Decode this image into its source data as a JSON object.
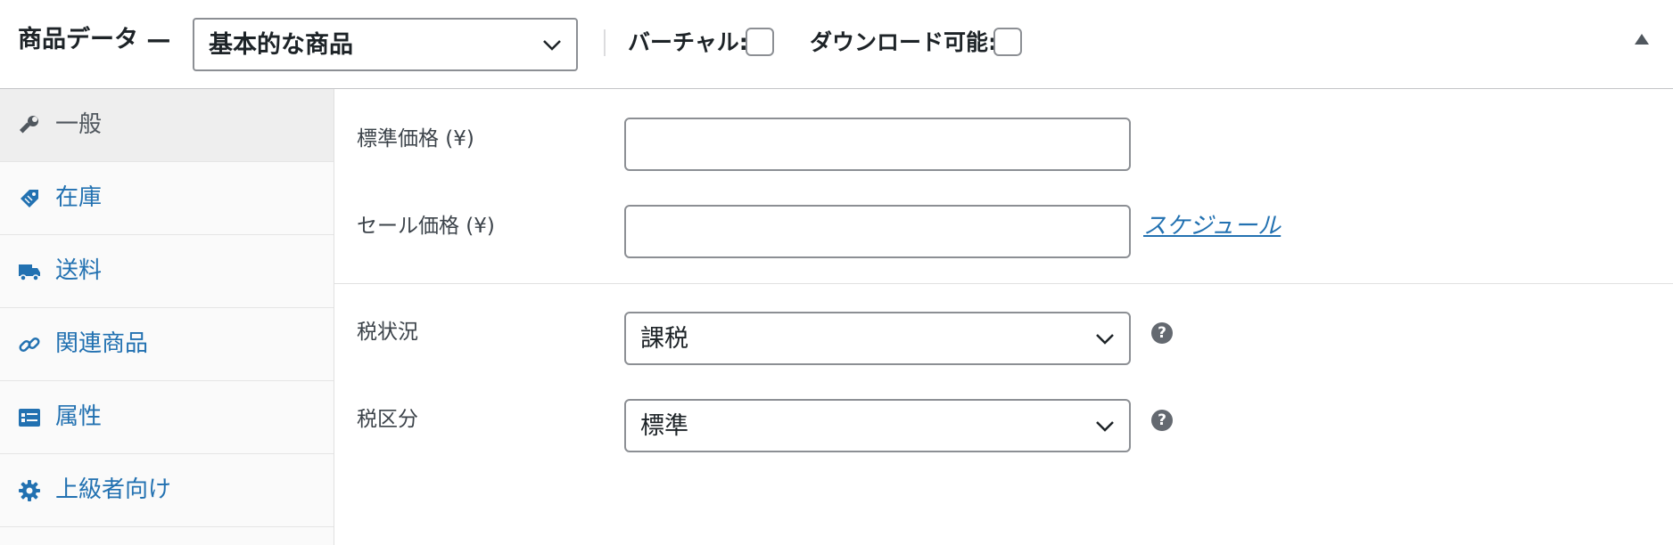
{
  "header": {
    "title": "商品データ —",
    "product_type": "基本的な商品",
    "virtual_label": "バーチャル:",
    "downloadable_label": "ダウンロード可能:"
  },
  "tabs": [
    {
      "label": "一般",
      "icon": "wrench-icon",
      "active": true
    },
    {
      "label": "在庫",
      "icon": "tag-icon",
      "active": false
    },
    {
      "label": "送料",
      "icon": "truck-icon",
      "active": false
    },
    {
      "label": "関連商品",
      "icon": "link-icon",
      "active": false
    },
    {
      "label": "属性",
      "icon": "list-card-icon",
      "active": false
    },
    {
      "label": "上級者向け",
      "icon": "gear-icon",
      "active": false
    }
  ],
  "general": {
    "regular_price_label": "標準価格 (¥)",
    "regular_price_value": "",
    "sale_price_label": "セール価格 (¥)",
    "sale_price_value": "",
    "schedule_link": "スケジュール",
    "tax_status_label": "税状況",
    "tax_status_value": "課税",
    "tax_class_label": "税区分",
    "tax_class_value": "標準",
    "help_glyph": "?"
  },
  "colors": {
    "link": "#2271b1",
    "border": "#8c8f94",
    "sidebar_bg": "#fafafa",
    "active_tab_bg": "#eeeeee"
  }
}
